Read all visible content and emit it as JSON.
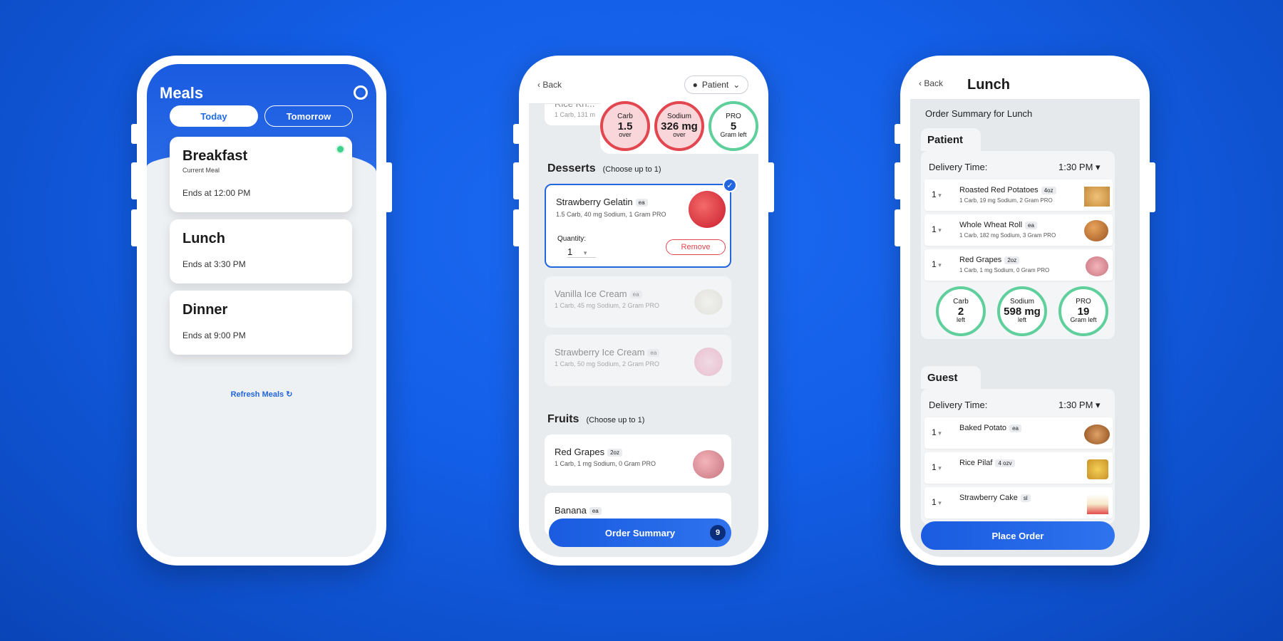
{
  "screen1": {
    "title": "Meals",
    "tabs": [
      "Today",
      "Tomorrow"
    ],
    "meals": [
      {
        "name": "Breakfast",
        "sub": "Current Meal",
        "ends": "Ends at 12:00 PM"
      },
      {
        "name": "Lunch",
        "ends": "Ends at 3:30 PM"
      },
      {
        "name": "Dinner",
        "ends": "Ends at 9:00 PM"
      }
    ],
    "refresh": "Refresh Meals ↻"
  },
  "screen2": {
    "back": "Back",
    "role": "Patient",
    "partial_item": "Rice Kri...",
    "partial_desc": "1 Carb, 131 m",
    "rings": [
      {
        "name": "Carb",
        "value": "1.5",
        "sub": "over"
      },
      {
        "name": "Sodium",
        "value": "326 mg",
        "sub": "over"
      },
      {
        "name": "PRO",
        "value": "5",
        "sub": "Gram left"
      }
    ],
    "desserts": {
      "title": "Desserts",
      "note": "(Choose up to 1)"
    },
    "selected": {
      "name": "Strawberry Gelatin",
      "tag": "ea",
      "desc": "1.5 Carb, 40 mg Sodium, 1 Gram PRO",
      "qty_label": "Quantity:",
      "qty": "1",
      "remove": "Remove"
    },
    "items": [
      {
        "name": "Vanilla Ice Cream",
        "tag": "ea",
        "desc": "1 Carb, 45 mg Sodium, 2 Gram PRO"
      },
      {
        "name": "Strawberry Ice Cream",
        "tag": "ea",
        "desc": "1 Carb, 50 mg Sodium, 2 Gram PRO"
      }
    ],
    "fruits": {
      "title": "Fruits",
      "note": "(Choose up to 1)"
    },
    "fruit_items": [
      {
        "name": "Red Grapes",
        "tag": "2oz",
        "desc": "1 Carb, 1 mg Sodium, 0 Gram PRO"
      },
      {
        "name": "Banana",
        "tag": "ea"
      }
    ],
    "order": "Order Summary",
    "count": "9"
  },
  "screen3": {
    "back": "Back",
    "title": "Lunch",
    "summary": "Order Summary for Lunch",
    "patient": "Patient",
    "guest": "Guest",
    "delivery_label": "Delivery Time:",
    "delivery_time": "1:30 PM ▾",
    "patient_items": [
      {
        "qty": "1",
        "name": "Roasted Red Potatoes",
        "tag": "4oz",
        "desc": "1 Carb, 19 mg Sodium, 2 Gram PRO"
      },
      {
        "qty": "1",
        "name": "Whole Wheat Roll",
        "tag": "ea",
        "desc": "1 Carb, 182 mg Sodium, 3 Gram PRO"
      },
      {
        "qty": "1",
        "name": "Red Grapes",
        "tag": "2oz",
        "desc": "1 Carb, 1 mg Sodium, 0 Gram PRO"
      }
    ],
    "rings": [
      {
        "name": "Carb",
        "value": "2",
        "sub": "left"
      },
      {
        "name": "Sodium",
        "value": "598 mg",
        "sub": "left"
      },
      {
        "name": "PRO",
        "value": "19",
        "sub": "Gram left"
      }
    ],
    "guest_items": [
      {
        "qty": "1",
        "name": "Baked Potato",
        "tag": "ea"
      },
      {
        "qty": "1",
        "name": "Rice Pilaf",
        "tag": "4 ozv"
      },
      {
        "qty": "1",
        "name": "Strawberry Cake",
        "tag": "sl"
      }
    ],
    "place": "Place Order"
  }
}
